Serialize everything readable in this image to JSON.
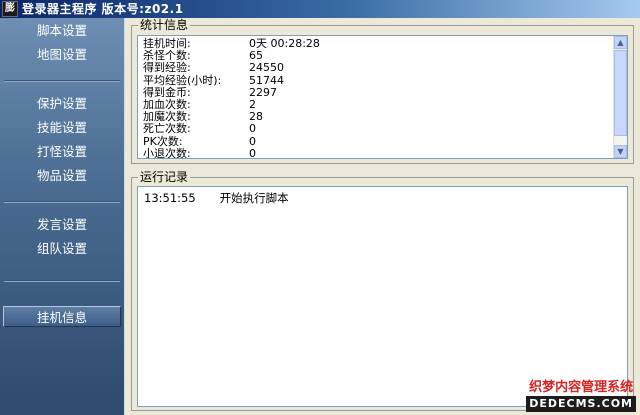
{
  "window": {
    "title": "登录器主程序 版本号:z02.1",
    "icon": "app-icon",
    "icon_glyph": "膨"
  },
  "sidebar": {
    "items": [
      {
        "label": "脚本设置"
      },
      {
        "label": "地图设置"
      },
      {
        "label": "保护设置"
      },
      {
        "label": "技能设置"
      },
      {
        "label": "打怪设置"
      },
      {
        "label": "物品设置"
      },
      {
        "label": "发言设置"
      },
      {
        "label": "组队设置"
      },
      {
        "label": "挂机信息",
        "active": true
      }
    ]
  },
  "stats": {
    "title": "统计信息",
    "rows": [
      {
        "label": "挂机时间:",
        "value": "0天 00:28:28"
      },
      {
        "label": "杀怪个数:",
        "value": "65"
      },
      {
        "label": "得到经验:",
        "value": "24550"
      },
      {
        "label": "平均经验(小时):",
        "value": "51744"
      },
      {
        "label": "得到金币:",
        "value": "2297"
      },
      {
        "label": "加血次数:",
        "value": "2"
      },
      {
        "label": "加魔次数:",
        "value": "28"
      },
      {
        "label": "死亡次数:",
        "value": "0"
      },
      {
        "label": "PK次数:",
        "value": "0"
      },
      {
        "label": "小退次数:",
        "value": "0"
      }
    ]
  },
  "log": {
    "title": "运行记录",
    "entries": [
      {
        "time": "13:51:55",
        "message": "开始执行脚本"
      }
    ]
  },
  "watermark": {
    "line1": "织梦内容管理系统",
    "line2": "DEDECMS.COM"
  },
  "colors": {
    "sidebar_top": "#6e8fb3",
    "sidebar_bottom": "#2e4a6c",
    "panel_bg": "#ece9d8",
    "scrollbar": "#c1d3fb"
  }
}
